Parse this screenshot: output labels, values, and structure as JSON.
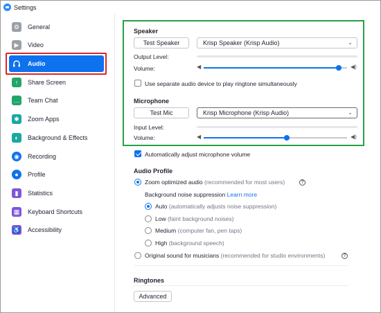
{
  "window": {
    "title": "Settings"
  },
  "sidebar": {
    "items": [
      {
        "label": "General",
        "icon": "gear-icon",
        "color": "#9aa0a6"
      },
      {
        "label": "Video",
        "icon": "video-icon",
        "color": "#9aa0a6"
      },
      {
        "label": "Audio",
        "icon": "headphones-icon",
        "color": "#0e72ed",
        "active": true
      },
      {
        "label": "Share Screen",
        "icon": "share-screen-icon",
        "color": "#22a56a"
      },
      {
        "label": "Team Chat",
        "icon": "chat-icon",
        "color": "#22a56a"
      },
      {
        "label": "Zoom Apps",
        "icon": "apps-icon",
        "color": "#19a8a0"
      },
      {
        "label": "Background & Effects",
        "icon": "background-icon",
        "color": "#19a8a0"
      },
      {
        "label": "Recording",
        "icon": "recording-icon",
        "color": "#0e72ed"
      },
      {
        "label": "Profile",
        "icon": "profile-icon",
        "color": "#0e72ed"
      },
      {
        "label": "Statistics",
        "icon": "statistics-icon",
        "color": "#7f56d9"
      },
      {
        "label": "Keyboard Shortcuts",
        "icon": "keyboard-icon",
        "color": "#7f56d9"
      },
      {
        "label": "Accessibility",
        "icon": "accessibility-icon",
        "color": "#7f56d9"
      }
    ]
  },
  "speaker": {
    "title": "Speaker",
    "test_label": "Test Speaker",
    "device": "Krisp Speaker (Krisp Audio)",
    "output_level_label": "Output Level:",
    "volume_label": "Volume:",
    "volume": 0.94,
    "separate_device_label": "Use separate audio device to play ringtone simultaneously",
    "separate_device_checked": false
  },
  "microphone": {
    "title": "Microphone",
    "test_label": "Test Mic",
    "device": "Krisp Microphone (Krisp Audio)",
    "input_level_label": "Input Level:",
    "volume_label": "Volume:",
    "volume": 0.58
  },
  "auto_adjust": {
    "label": "Automatically adjust microphone volume",
    "checked": true
  },
  "audio_profile": {
    "title": "Audio Profile",
    "zoom_optimized": {
      "label": "Zoom optimized audio",
      "hint": "(recommended for most users)",
      "selected": true
    },
    "noise_label": "Background noise suppression",
    "learn_more": "Learn more",
    "noise_options": [
      {
        "label": "Auto",
        "hint": "(automatically adjusts noise suppression)",
        "selected": true
      },
      {
        "label": "Low",
        "hint": "(faint background noises)",
        "selected": false
      },
      {
        "label": "Medium",
        "hint": "(computer fan, pen taps)",
        "selected": false
      },
      {
        "label": "High",
        "hint": "(background speech)",
        "selected": false
      }
    ],
    "original_sound": {
      "label": "Original sound for musicians",
      "hint": "(recommended for studio environments)",
      "selected": false
    }
  },
  "ringtones": {
    "title": "Ringtones"
  },
  "advanced_label": "Advanced",
  "colors": {
    "accent": "#0e72ed",
    "highlight_red": "#d9252a",
    "highlight_green": "#25a244"
  }
}
